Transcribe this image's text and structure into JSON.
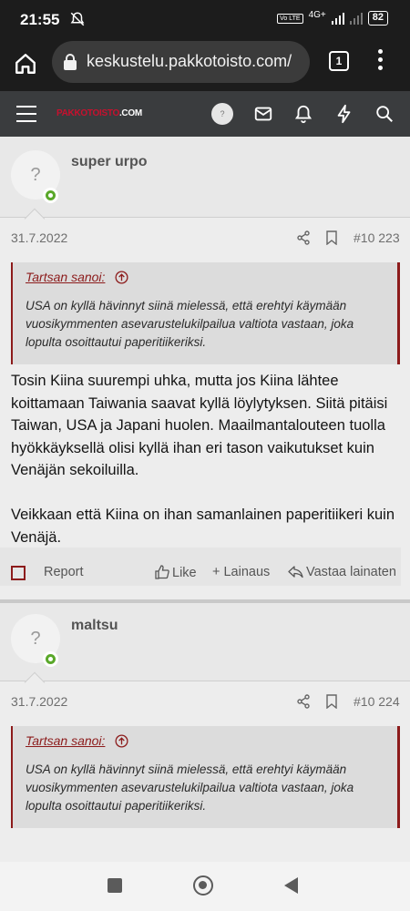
{
  "status_bar": {
    "time": "21:55",
    "network_badge": "Vo LTE",
    "network_type": "4G+",
    "battery": "82"
  },
  "browser": {
    "url": "keskustelu.pakkotoisto.com/",
    "tab_count": "1"
  },
  "site": {
    "logo_red": "PAKKOTOISTO",
    "logo_white": ".COM",
    "avatar_placeholder": "?"
  },
  "posts": [
    {
      "username": "super urpo",
      "avatar": "?",
      "date": "31.7.2022",
      "number": "#10 223",
      "quote_author": "Tartsan sanoi:",
      "quote_text": "USA on kyllä hävinnyt siinä mielessä, että erehtyi käymään vuosikymmenten asevarustelukilpailua valtiota vastaan, joka lopulta osoittautui paperitiikeriksi.",
      "paragraphs": [
        "Tosin Kiina suurempi uhka, mutta jos Kiina lähtee koittamaan Taiwania saavat kyllä löylytyksen. Siitä pitäisi Taiwan, USA ja Japani huolen. Maailmantalouteen tuolla hyökkäyksellä olisi kyllä ihan eri tason vaikutukset kuin Venäjän sekoiluilla.",
        "Veikkaan että Kiina on ihan samanlainen paperitiikeri kuin Venäjä."
      ],
      "actions": {
        "report": "Report",
        "like": "Like",
        "quote": "+ Lainaus",
        "reply": "Vastaa lainaten"
      }
    },
    {
      "username": "maltsu",
      "avatar": "?",
      "date": "31.7.2022",
      "number": "#10 224",
      "quote_author": "Tartsan sanoi:",
      "quote_text": "USA on kyllä hävinnyt siinä mielessä, että erehtyi käymään vuosikymmenten asevarustelukilpailua valtiota vastaan, joka lopulta osoittautui paperitiikeriksi."
    }
  ],
  "icons": {
    "status": [
      "mute-bell-icon",
      "signal-icon",
      "battery-icon"
    ],
    "browser": [
      "home-icon",
      "lock-icon",
      "tabs-icon",
      "more-vert-icon"
    ],
    "header": [
      "hamburger-icon",
      "mail-icon",
      "bell-icon",
      "bolt-icon",
      "search-icon"
    ],
    "post": [
      "share-icon",
      "bookmark-icon",
      "arrow-up-circle-icon",
      "thumb-up-icon",
      "reply-icon"
    ],
    "nav": [
      "recents-square-icon",
      "home-circle-icon",
      "back-triangle-icon"
    ]
  },
  "colors": {
    "brand_red": "#8c1b1b",
    "header_bg": "#3a3c3e",
    "online_green": "#5aa82a"
  }
}
